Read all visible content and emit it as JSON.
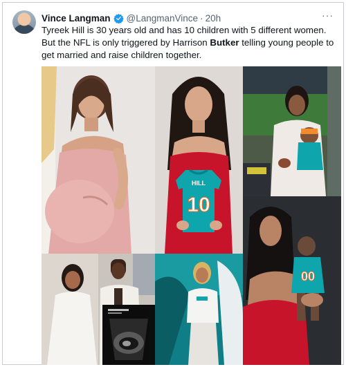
{
  "tweet": {
    "author_name": "Vince Langman",
    "author_handle": "@LangmanVince",
    "separator": "·",
    "timestamp": "20h",
    "more_label": "···",
    "text_part1": "Tyreek Hill is 30 years old and has 10 children with 5 different women. But the NFL is  only triggered by Harrison ",
    "text_bold": "Butker",
    "text_part2": " telling young people to get married and raise children together."
  },
  "media": {
    "jersey_name": "HILL",
    "jersey_number": "10",
    "onesie_number": "00"
  },
  "colors": {
    "verified": "#1d9bf0",
    "text": "#0f1419",
    "muted": "#536471",
    "teal": "#0ea5ad",
    "red_dress": "#c8142b"
  }
}
